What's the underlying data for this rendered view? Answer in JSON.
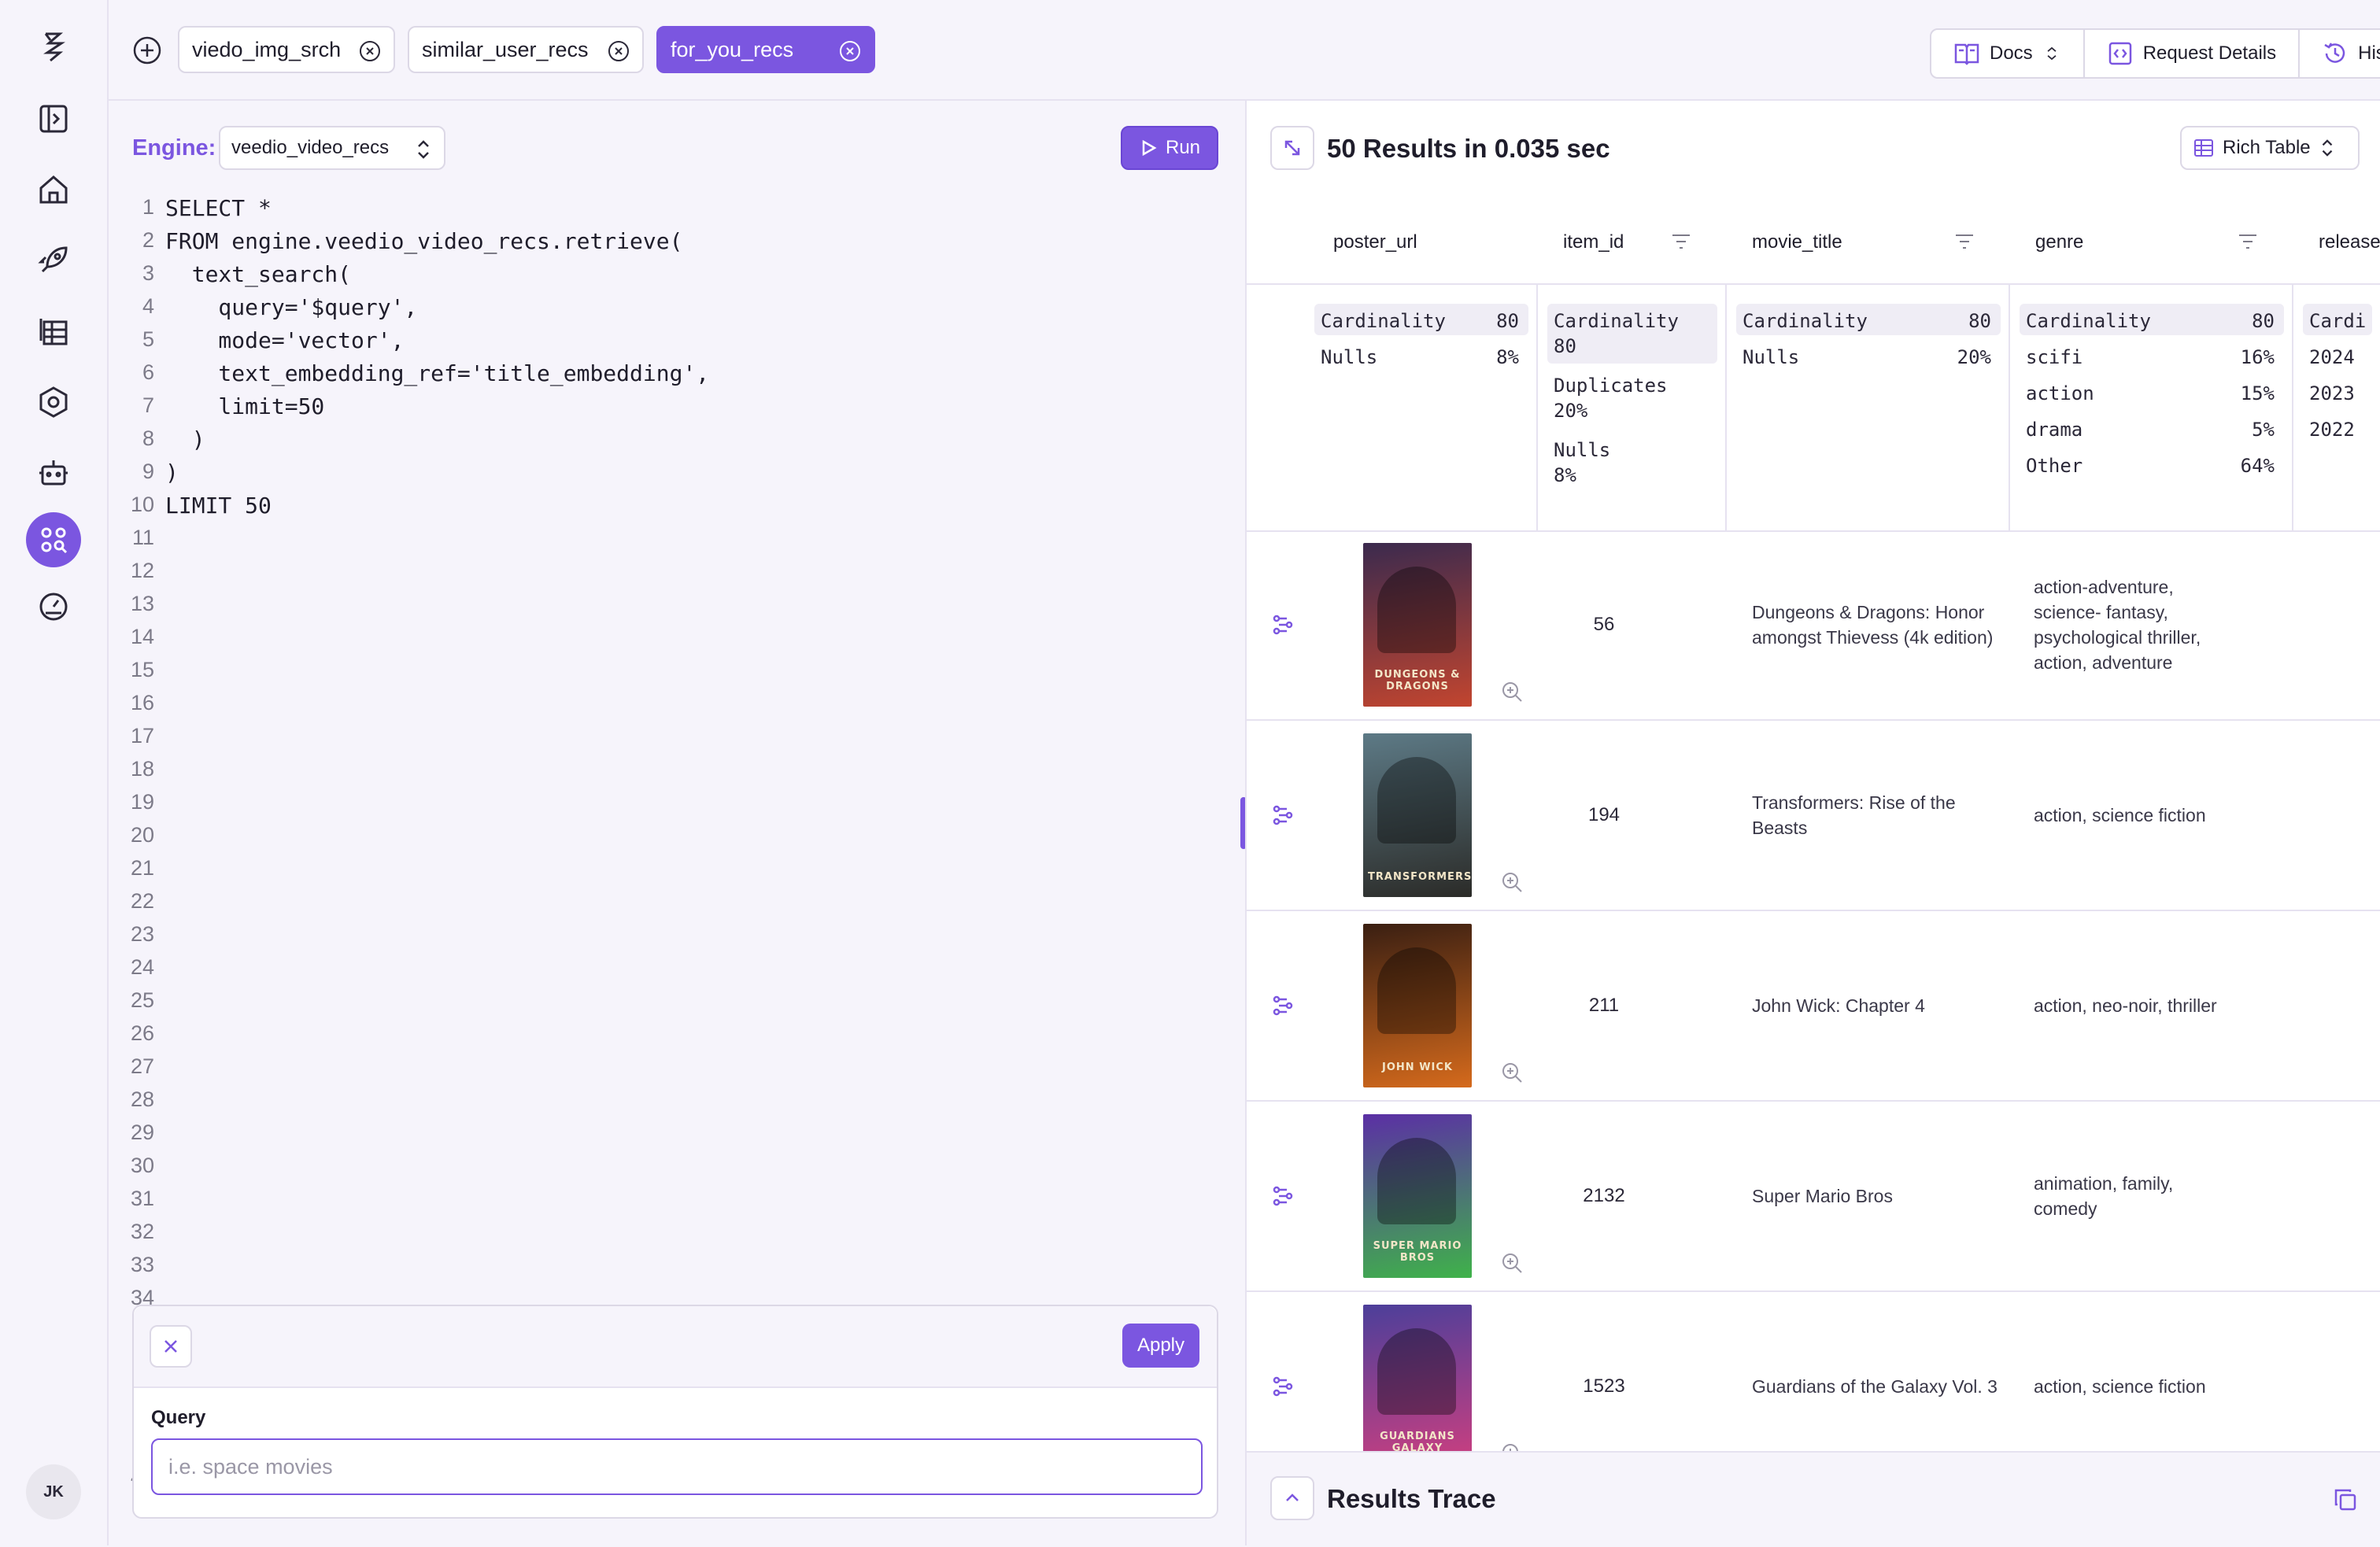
{
  "tabs": [
    {
      "label": "viedo_img_srch"
    },
    {
      "label": "similar_user_recs"
    },
    {
      "label": "for_you_recs"
    }
  ],
  "top_actions": {
    "docs": "Docs",
    "request_details": "Request Details",
    "history": "History"
  },
  "sidebar": {
    "avatar_initials": "JK"
  },
  "editor": {
    "engine_label": "Engine:",
    "engine_value": "veedio_video_recs",
    "run_label": "Run",
    "lines": [
      {
        "n": "1",
        "code": "SELECT *"
      },
      {
        "n": "2",
        "code": "FROM engine.veedio_video_recs.retrieve("
      },
      {
        "n": "3",
        "code": "  text_search("
      },
      {
        "n": "4",
        "code": "    query='$query',"
      },
      {
        "n": "5",
        "code": "    mode='vector',"
      },
      {
        "n": "6",
        "code": "    text_embedding_ref='title_embedding',"
      },
      {
        "n": "7",
        "code": "    limit=50"
      },
      {
        "n": "8",
        "code": "  )"
      },
      {
        "n": "9",
        "code": ")"
      },
      {
        "n": "10",
        "code": "LIMIT 50"
      },
      {
        "n": "11",
        "code": ""
      },
      {
        "n": "12",
        "code": ""
      },
      {
        "n": "13",
        "code": ""
      },
      {
        "n": "14",
        "code": ""
      },
      {
        "n": "15",
        "code": ""
      },
      {
        "n": "16",
        "code": ""
      },
      {
        "n": "17",
        "code": ""
      },
      {
        "n": "18",
        "code": ""
      },
      {
        "n": "19",
        "code": ""
      },
      {
        "n": "20",
        "code": ""
      },
      {
        "n": "21",
        "code": ""
      },
      {
        "n": "22",
        "code": ""
      },
      {
        "n": "23",
        "code": ""
      },
      {
        "n": "24",
        "code": ""
      },
      {
        "n": "25",
        "code": ""
      },
      {
        "n": "26",
        "code": ""
      },
      {
        "n": "27",
        "code": ""
      },
      {
        "n": "28",
        "code": ""
      },
      {
        "n": "29",
        "code": ""
      },
      {
        "n": "30",
        "code": ""
      },
      {
        "n": "31",
        "code": ""
      },
      {
        "n": "32",
        "code": ""
      },
      {
        "n": "33",
        "code": ""
      },
      {
        "n": "34",
        "code": ""
      },
      {
        "n": "41",
        "code": ""
      }
    ]
  },
  "query_popup": {
    "apply_label": "Apply",
    "field_label": "Query",
    "placeholder": "i.e. space movies",
    "value": ""
  },
  "results": {
    "title": "50 Results in 0.035 sec",
    "view_mode": "Rich Table",
    "columns": [
      "poster_url",
      "item_id",
      "movie_title",
      "genre",
      "release"
    ],
    "stats": {
      "poster_url": [
        {
          "k": "Cardinality",
          "v": "80"
        },
        {
          "k": "Nulls",
          "v": "8%"
        }
      ],
      "item_id": [
        {
          "k": "Cardinality",
          "v": "80"
        },
        {
          "k": "Duplicates",
          "v": "20%"
        },
        {
          "k": "Nulls",
          "v": "8%"
        }
      ],
      "movie_title": [
        {
          "k": "Cardinality",
          "v": "80"
        },
        {
          "k": "Nulls",
          "v": "20%"
        }
      ],
      "genre": [
        {
          "k": "Cardinality",
          "v": "80"
        },
        {
          "k": "scifi",
          "v": "16%"
        },
        {
          "k": "action",
          "v": "15%"
        },
        {
          "k": "drama",
          "v": "5%"
        },
        {
          "k": "Other",
          "v": "64%"
        }
      ],
      "release": [
        {
          "k": "Cardi",
          "v": ""
        },
        {
          "k": "2024",
          "v": ""
        },
        {
          "k": "2023",
          "v": ""
        },
        {
          "k": "2022",
          "v": ""
        }
      ]
    },
    "rows": [
      {
        "item_id": "56",
        "movie_title": "Dungeons & Dragons: Honor amongst Thievess (4k edition)",
        "genre": "action-adventure, science- fantasy, psychological thriller, action, adventure",
        "poster_colors": [
          "#3b2a4e",
          "#c2452f"
        ],
        "poster_text": "DUNGEONS & DRAGONS"
      },
      {
        "item_id": "194",
        "movie_title": "Transformers: Rise of the Beasts",
        "genre": "action, science fiction",
        "poster_colors": [
          "#5d7a86",
          "#2b2b28"
        ],
        "poster_text": "TRANSFORMERS"
      },
      {
        "item_id": "211",
        "movie_title": "John Wick: Chapter 4",
        "genre": "action, neo-noir, thriller",
        "poster_colors": [
          "#3a1f12",
          "#d56a1c"
        ],
        "poster_text": "JOHN WICK"
      },
      {
        "item_id": "2132",
        "movie_title": "Super Mario Bros",
        "genre": "animation, family, comedy",
        "poster_colors": [
          "#5b2fa5",
          "#3fb24a"
        ],
        "poster_text": "SUPER MARIO BROS"
      },
      {
        "item_id": "1523",
        "movie_title": "Guardians of the Galaxy Vol. 3",
        "genre": "action, science fiction",
        "poster_colors": [
          "#4c3f9a",
          "#cf3f7f"
        ],
        "poster_text": "GUARDIANS GALAXY"
      }
    ],
    "trace_title": "Results Trace"
  },
  "colors": {
    "accent": "#7b56e0",
    "border": "#dcd8e6",
    "background": "#f6f4fb"
  }
}
